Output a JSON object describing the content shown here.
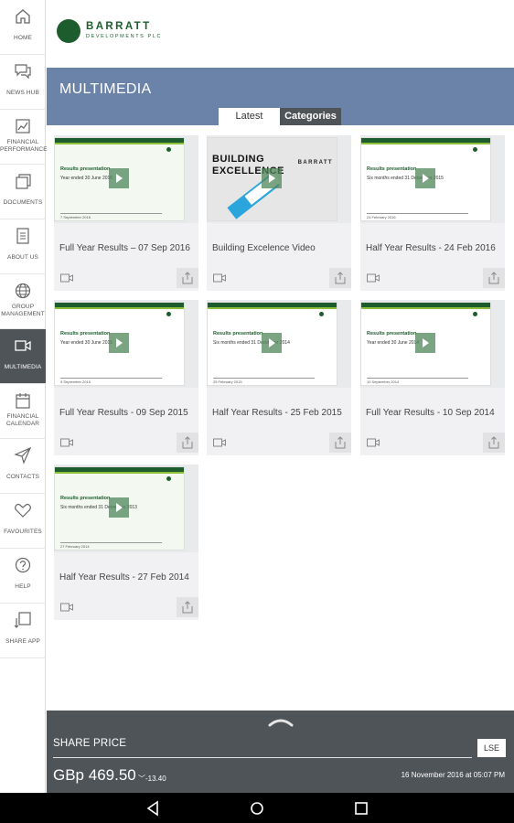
{
  "brand": {
    "name": "BARRATT",
    "tagline": "DEVELOPMENTS PLC"
  },
  "sidebar": {
    "items": [
      {
        "id": "home",
        "label": "HOME",
        "icon": "home-icon"
      },
      {
        "id": "news-hub",
        "label": "NEWS HUB",
        "icon": "chat-icon"
      },
      {
        "id": "financial-performance",
        "label": "FINANCIAL\nPERFORMANCE",
        "icon": "chart-icon"
      },
      {
        "id": "documents",
        "label": "DOCUMENTS",
        "icon": "document-icon"
      },
      {
        "id": "about-us",
        "label": "ABOUT US",
        "icon": "page-icon"
      },
      {
        "id": "group-management",
        "label": "GROUP\nMANAGEMENT",
        "icon": "globe-icon"
      },
      {
        "id": "multimedia",
        "label": "MULTIMEDIA",
        "icon": "video-icon",
        "active": true
      },
      {
        "id": "financial-calendar",
        "label": "FINANCIAL\nCALENDAR",
        "icon": "calendar-icon"
      },
      {
        "id": "contacts",
        "label": "CONTACTS",
        "icon": "send-icon"
      },
      {
        "id": "favourites",
        "label": "FAVOURITES",
        "icon": "heart-icon"
      },
      {
        "id": "help",
        "label": "HELP",
        "icon": "help-icon"
      },
      {
        "id": "share-app",
        "label": "SHARE APP",
        "icon": "share-app-icon"
      }
    ]
  },
  "page": {
    "title": "MULTIMEDIA",
    "tabs": [
      {
        "label": "Latest",
        "active": false
      },
      {
        "label": "Categories",
        "active": true
      }
    ]
  },
  "videos": [
    {
      "title": "Full Year Results – 07 Sep 2016",
      "slide_title": "Results presentation",
      "slide_sub": "Year ended 30 June 2016",
      "slide_date": "7 September 2016"
    },
    {
      "title": "Building Excelence Video",
      "slide_title": "BUILDING\nEXCELLENCE",
      "slide_brand": "BARRATT"
    },
    {
      "title": "Half Year Results - 24 Feb 2016",
      "slide_title": "Results presentation",
      "slide_sub": "Six months ended 31 December 2015",
      "slide_date": "24 February 2016"
    },
    {
      "title": "Full Year Results - 09 Sep 2015",
      "slide_title": "Results presentation",
      "slide_sub": "Year ended 30 June 2015",
      "slide_date": "9 September 2015"
    },
    {
      "title": "Half Year Results - 25 Feb 2015",
      "slide_title": "Results presentation",
      "slide_sub": "Six months ended 31 December 2014",
      "slide_date": "25 February 2015"
    },
    {
      "title": "Full Year Results - 10 Sep 2014",
      "slide_title": "Results presentation",
      "slide_sub": "Year ended 30 June 2014",
      "slide_date": "10 September 2014"
    },
    {
      "title": "Half Year Results - 27 Feb 2014",
      "slide_title": "Results presentation",
      "slide_sub": "Six months ended 31 December 2013",
      "slide_date": "27 February 2014"
    }
  ],
  "share_price": {
    "label": "SHARE PRICE",
    "exchange": "LSE",
    "price": "GBp 469.50",
    "change": "-13.40",
    "direction": "down",
    "timestamp": "16 November 2016 at 05:07 PM"
  },
  "colors": {
    "brand_green": "#1d5c2c",
    "header_blue": "#6b83a8",
    "dark_gray": "#4f5459",
    "accent_lime": "#8fbf3c"
  }
}
